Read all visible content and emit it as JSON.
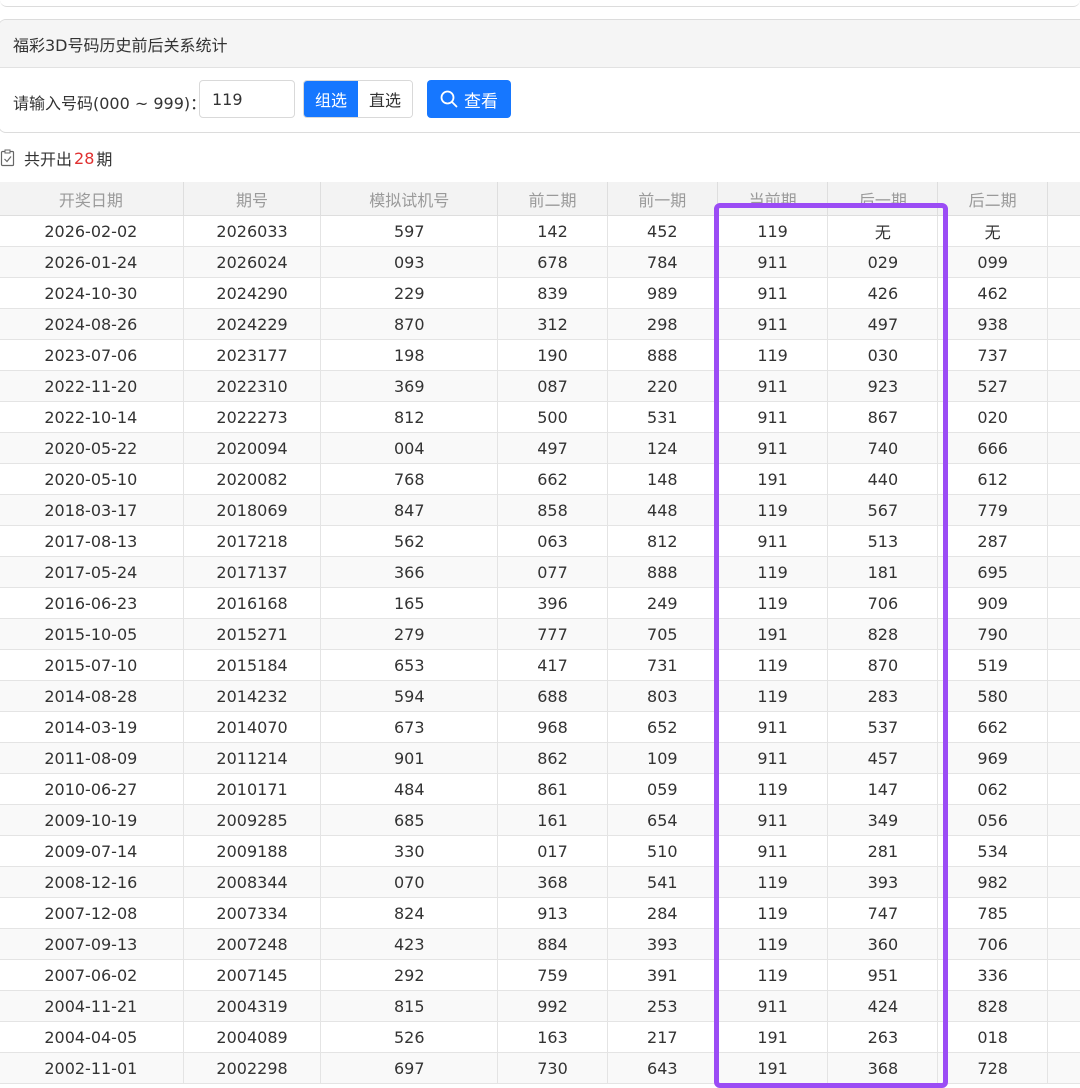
{
  "panel": {
    "title": "福彩3D号码历史前后关系统计",
    "input_label": "请输入号码(000 ~ 999)：",
    "input_value": "119",
    "mode_options": [
      "组选",
      "直选"
    ],
    "mode_selected": "组选",
    "search_label": "查看"
  },
  "summary": {
    "prefix": "共开出",
    "count": "28",
    "suffix": "期"
  },
  "table": {
    "headers": [
      "开奖日期",
      "期号",
      "模拟试机号",
      "前二期",
      "前一期",
      "当前期",
      "后一期",
      "后二期"
    ],
    "rows": [
      [
        "2026-02-02",
        "2026033",
        "597",
        "142",
        "452",
        "119",
        "无",
        "无"
      ],
      [
        "2026-01-24",
        "2026024",
        "093",
        "678",
        "784",
        "911",
        "029",
        "099"
      ],
      [
        "2024-10-30",
        "2024290",
        "229",
        "839",
        "989",
        "911",
        "426",
        "462"
      ],
      [
        "2024-08-26",
        "2024229",
        "870",
        "312",
        "298",
        "911",
        "497",
        "938"
      ],
      [
        "2023-07-06",
        "2023177",
        "198",
        "190",
        "888",
        "119",
        "030",
        "737"
      ],
      [
        "2022-11-20",
        "2022310",
        "369",
        "087",
        "220",
        "911",
        "923",
        "527"
      ],
      [
        "2022-10-14",
        "2022273",
        "812",
        "500",
        "531",
        "911",
        "867",
        "020"
      ],
      [
        "2020-05-22",
        "2020094",
        "004",
        "497",
        "124",
        "911",
        "740",
        "666"
      ],
      [
        "2020-05-10",
        "2020082",
        "768",
        "662",
        "148",
        "191",
        "440",
        "612"
      ],
      [
        "2018-03-17",
        "2018069",
        "847",
        "858",
        "448",
        "119",
        "567",
        "779"
      ],
      [
        "2017-08-13",
        "2017218",
        "562",
        "063",
        "812",
        "911",
        "513",
        "287"
      ],
      [
        "2017-05-24",
        "2017137",
        "366",
        "077",
        "888",
        "119",
        "181",
        "695"
      ],
      [
        "2016-06-23",
        "2016168",
        "165",
        "396",
        "249",
        "119",
        "706",
        "909"
      ],
      [
        "2015-10-05",
        "2015271",
        "279",
        "777",
        "705",
        "191",
        "828",
        "790"
      ],
      [
        "2015-07-10",
        "2015184",
        "653",
        "417",
        "731",
        "119",
        "870",
        "519"
      ],
      [
        "2014-08-28",
        "2014232",
        "594",
        "688",
        "803",
        "119",
        "283",
        "580"
      ],
      [
        "2014-03-19",
        "2014070",
        "673",
        "968",
        "652",
        "911",
        "537",
        "662"
      ],
      [
        "2011-08-09",
        "2011214",
        "901",
        "862",
        "109",
        "911",
        "457",
        "969"
      ],
      [
        "2010-06-27",
        "2010171",
        "484",
        "861",
        "059",
        "119",
        "147",
        "062"
      ],
      [
        "2009-10-19",
        "2009285",
        "685",
        "161",
        "654",
        "911",
        "349",
        "056"
      ],
      [
        "2009-07-14",
        "2009188",
        "330",
        "017",
        "510",
        "911",
        "281",
        "534"
      ],
      [
        "2008-12-16",
        "2008344",
        "070",
        "368",
        "541",
        "119",
        "393",
        "982"
      ],
      [
        "2007-12-08",
        "2007334",
        "824",
        "913",
        "284",
        "119",
        "747",
        "785"
      ],
      [
        "2007-09-13",
        "2007248",
        "423",
        "884",
        "393",
        "119",
        "360",
        "706"
      ],
      [
        "2007-06-02",
        "2007145",
        "292",
        "759",
        "391",
        "119",
        "951",
        "336"
      ],
      [
        "2004-11-21",
        "2004319",
        "815",
        "992",
        "253",
        "911",
        "424",
        "828"
      ],
      [
        "2004-04-05",
        "2004089",
        "526",
        "163",
        "217",
        "191",
        "263",
        "018"
      ],
      [
        "2002-11-01",
        "2002298",
        "697",
        "730",
        "643",
        "191",
        "368",
        "728"
      ]
    ]
  },
  "colors": {
    "primary": "#1677ff",
    "count_red": "#e03030",
    "highlight_purple": "#9b4cf5"
  },
  "icons": {
    "search": "search-icon",
    "summary": "clipboard-check-icon"
  }
}
